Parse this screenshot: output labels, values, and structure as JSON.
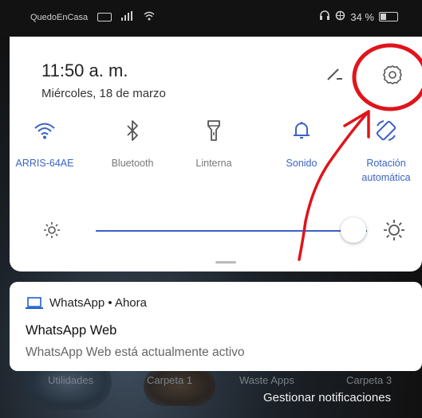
{
  "status_bar": {
    "carrier": "QuedoEnCasa",
    "battery_text": "34 %",
    "battery_level": 0.34
  },
  "quick_settings": {
    "time": "11:50 a. m.",
    "date": "Miércoles, 18 de marzo",
    "tiles": [
      {
        "label": "ARRIS-64AE",
        "icon": "wifi-icon",
        "active": true
      },
      {
        "label": "Bluetooth",
        "icon": "bluetooth-icon",
        "active": false
      },
      {
        "label": "Linterna",
        "icon": "flashlight-icon",
        "active": false
      },
      {
        "label": "Sonido",
        "icon": "bell-icon",
        "active": true
      },
      {
        "label": "Rotación automática",
        "icon": "rotation-icon",
        "active": true
      }
    ],
    "brightness_level": 0.95
  },
  "notification": {
    "app_line": "WhatsApp • Ahora",
    "title": "WhatsApp Web",
    "body": "WhatsApp Web está actualmente activo"
  },
  "home_labels": [
    "Utilidades",
    "Carpeta 1",
    "Waste Apps",
    "Carpeta 3"
  ],
  "manage_notifications": "Gestionar notificaciones",
  "colors": {
    "accent": "#3b62c4",
    "annotation": "#e0141b"
  }
}
